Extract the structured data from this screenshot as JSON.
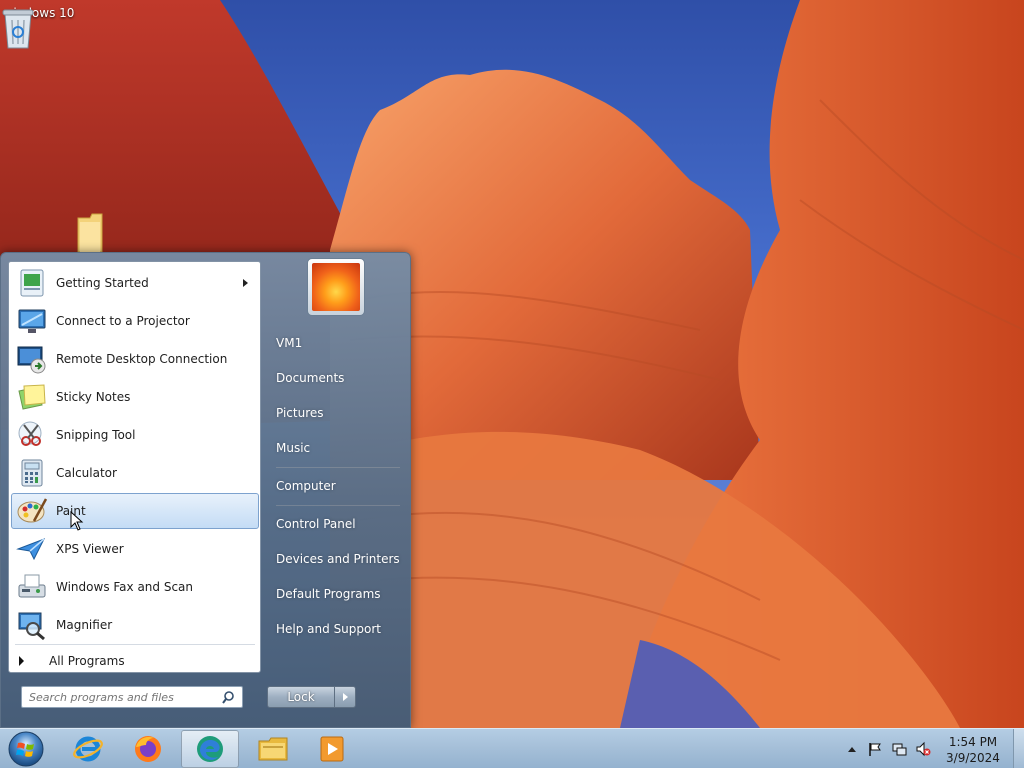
{
  "desktop": {
    "icons": [
      {
        "label": "windows 10",
        "icon": "recycle-bin-icon"
      },
      {
        "label": "",
        "icon": "folder-icon"
      }
    ]
  },
  "start_menu": {
    "programs": [
      {
        "label": "Getting Started",
        "icon": "getting-started-icon",
        "has_submenu": true
      },
      {
        "label": "Connect to a Projector",
        "icon": "projector-icon"
      },
      {
        "label": "Remote Desktop Connection",
        "icon": "remote-desktop-icon"
      },
      {
        "label": "Sticky Notes",
        "icon": "sticky-notes-icon"
      },
      {
        "label": "Snipping Tool",
        "icon": "snipping-tool-icon"
      },
      {
        "label": "Calculator",
        "icon": "calculator-icon"
      },
      {
        "label": "Paint",
        "icon": "paint-icon",
        "highlighted": true
      },
      {
        "label": "XPS Viewer",
        "icon": "xps-viewer-icon"
      },
      {
        "label": "Windows Fax and Scan",
        "icon": "fax-scan-icon"
      },
      {
        "label": "Magnifier",
        "icon": "magnifier-icon"
      }
    ],
    "all_programs": "All Programs",
    "search_placeholder": "Search programs and files",
    "right_items": [
      "VM1",
      "Documents",
      "Pictures",
      "Music",
      "Computer",
      "Control Panel",
      "Devices and Printers",
      "Default Programs",
      "Help and Support"
    ],
    "lock_label": "Lock"
  },
  "taskbar": {
    "pinned": [
      {
        "name": "start-orb",
        "icon": "windows-logo-icon"
      },
      {
        "name": "internet-explorer",
        "icon": "internet-explorer-icon"
      },
      {
        "name": "firefox",
        "icon": "firefox-icon"
      },
      {
        "name": "edge",
        "icon": "edge-icon",
        "active": true
      },
      {
        "name": "file-explorer",
        "icon": "folder-icon"
      },
      {
        "name": "media-player",
        "icon": "media-player-icon"
      }
    ],
    "tray": {
      "icons": [
        "show-hidden-icons-arrow",
        "action-center-flag-icon",
        "network-icon",
        "volume-muted-icon"
      ],
      "time": "1:54 PM",
      "date": "3/9/2024"
    }
  },
  "colors": {
    "menu_frame": "#6c86a3",
    "highlight": "#c4dcf5",
    "taskbar": "#a6c0d9"
  }
}
